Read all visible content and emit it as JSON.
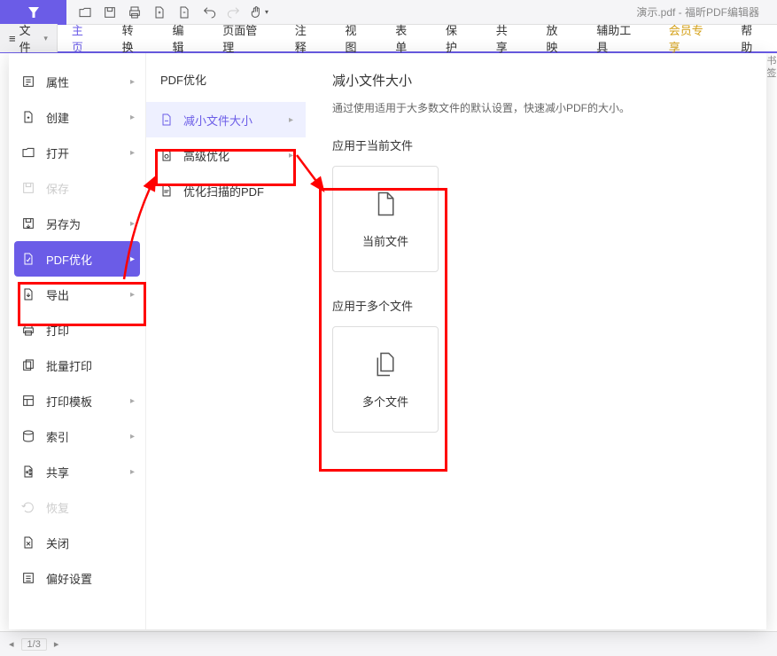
{
  "app": {
    "doc_title": "演示.pdf - 福昕PDF编辑器"
  },
  "menubar": {
    "file_btn": "文件",
    "items": [
      "主页",
      "转换",
      "编辑",
      "页面管理",
      "注释",
      "视图",
      "表单",
      "保护",
      "共享",
      "放映",
      "辅助工具",
      "会员专享",
      "帮助"
    ]
  },
  "sidebar": {
    "items": [
      {
        "label": "属性",
        "has_sub": true
      },
      {
        "label": "创建",
        "has_sub": true
      },
      {
        "label": "打开",
        "has_sub": true
      },
      {
        "label": "保存",
        "disabled": true
      },
      {
        "label": "另存为",
        "has_sub": true
      },
      {
        "label": "PDF优化",
        "has_sub": true,
        "selected": true
      },
      {
        "label": "导出",
        "has_sub": true
      },
      {
        "label": "打印"
      },
      {
        "label": "批量打印"
      },
      {
        "label": "打印模板",
        "has_sub": true
      },
      {
        "label": "索引",
        "has_sub": true
      },
      {
        "label": "共享",
        "has_sub": true
      },
      {
        "label": "恢复",
        "disabled": true
      },
      {
        "label": "关闭"
      },
      {
        "label": "偏好设置"
      }
    ]
  },
  "submenu": {
    "title": "PDF优化",
    "items": [
      {
        "label": "减小文件大小",
        "selected": true,
        "has_sub": true
      },
      {
        "label": "高级优化",
        "has_sub": true
      },
      {
        "label": "优化扫描的PDF"
      }
    ]
  },
  "content": {
    "title": "减小文件大小",
    "desc": "通过使用适用于大多数文件的默认设置，快速减小PDF的大小。",
    "section1_label": "应用于当前文件",
    "card1_label": "当前文件",
    "section2_label": "应用于多个文件",
    "card2_label": "多个文件"
  },
  "status": {
    "page": "1/3"
  },
  "right_tabs": [
    "书",
    "签"
  ]
}
